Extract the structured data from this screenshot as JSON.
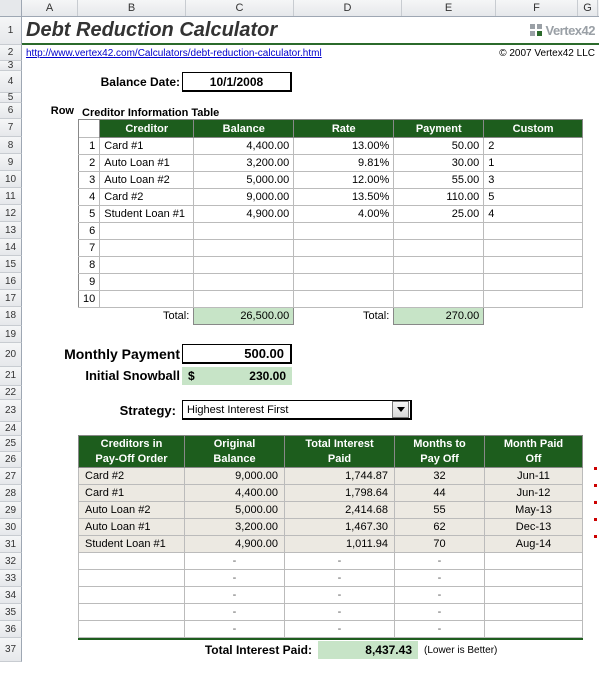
{
  "columns": [
    "A",
    "B",
    "C",
    "D",
    "E",
    "F",
    "G"
  ],
  "rows": [
    "1",
    "2",
    "3",
    "4",
    "5",
    "6",
    "7",
    "8",
    "9",
    "10",
    "11",
    "12",
    "13",
    "14",
    "15",
    "16",
    "17",
    "18",
    "19",
    "20",
    "21",
    "22",
    "23",
    "24",
    "25",
    "26",
    "27",
    "28",
    "29",
    "30",
    "31",
    "32",
    "33",
    "34",
    "35",
    "36",
    "37"
  ],
  "title": "Debt Reduction Calculator",
  "url": "http://www.vertex42.com/Calculators/debt-reduction-calculator.html",
  "copyright": "© 2007 Vertex42 LLC",
  "logo_text": "Vertex42",
  "balance_date_label": "Balance Date:",
  "balance_date": "10/1/2008",
  "creditor_table_title": "Creditor Information Table",
  "row_label": "Row",
  "creditor_headers": [
    "Creditor",
    "Balance",
    "Rate",
    "Payment",
    "Custom"
  ],
  "creditors": [
    {
      "n": "1",
      "name": "Card #1",
      "bal": "4,400.00",
      "rate": "13.00%",
      "pay": "50.00",
      "custom": "2"
    },
    {
      "n": "2",
      "name": "Auto Loan #1",
      "bal": "3,200.00",
      "rate": "9.81%",
      "pay": "30.00",
      "custom": "1"
    },
    {
      "n": "3",
      "name": "Auto Loan #2",
      "bal": "5,000.00",
      "rate": "12.00%",
      "pay": "55.00",
      "custom": "3"
    },
    {
      "n": "4",
      "name": "Card #2",
      "bal": "9,000.00",
      "rate": "13.50%",
      "pay": "110.00",
      "custom": "5"
    },
    {
      "n": "5",
      "name": "Student Loan #1",
      "bal": "4,900.00",
      "rate": "4.00%",
      "pay": "25.00",
      "custom": "4"
    },
    {
      "n": "6"
    },
    {
      "n": "7"
    },
    {
      "n": "8"
    },
    {
      "n": "9"
    },
    {
      "n": "10"
    }
  ],
  "total_label": "Total:",
  "total_balance": "26,500.00",
  "total_payment": "270.00",
  "monthly_payment_label": "Monthly Payment",
  "monthly_payment": "500.00",
  "initial_snowball_label": "Initial Snowball",
  "initial_snowball": "230.00",
  "dollar": "$",
  "strategy_label": "Strategy:",
  "strategy_value": "Highest Interest First",
  "payoff_headers_top": [
    "Creditors in",
    "Original",
    "Total Interest",
    "Months to",
    "Month Paid"
  ],
  "payoff_headers_bot": [
    "Pay-Off Order",
    "Balance",
    "Paid",
    "Pay Off",
    "Off"
  ],
  "payoff": [
    {
      "name": "Card #2",
      "bal": "9,000.00",
      "int": "1,744.87",
      "mo": "32",
      "paid": "Jun-11"
    },
    {
      "name": "Card #1",
      "bal": "4,400.00",
      "int": "1,798.64",
      "mo": "44",
      "paid": "Jun-12"
    },
    {
      "name": "Auto Loan #2",
      "bal": "5,000.00",
      "int": "2,414.68",
      "mo": "55",
      "paid": "May-13"
    },
    {
      "name": "Auto Loan #1",
      "bal": "3,200.00",
      "int": "1,467.30",
      "mo": "62",
      "paid": "Dec-13"
    },
    {
      "name": "Student Loan #1",
      "bal": "4,900.00",
      "int": "1,011.94",
      "mo": "70",
      "paid": "Aug-14"
    }
  ],
  "dash": "-",
  "total_interest_label": "Total Interest Paid:",
  "total_interest": "8,437.43",
  "lower_better": "(Lower is Better)"
}
